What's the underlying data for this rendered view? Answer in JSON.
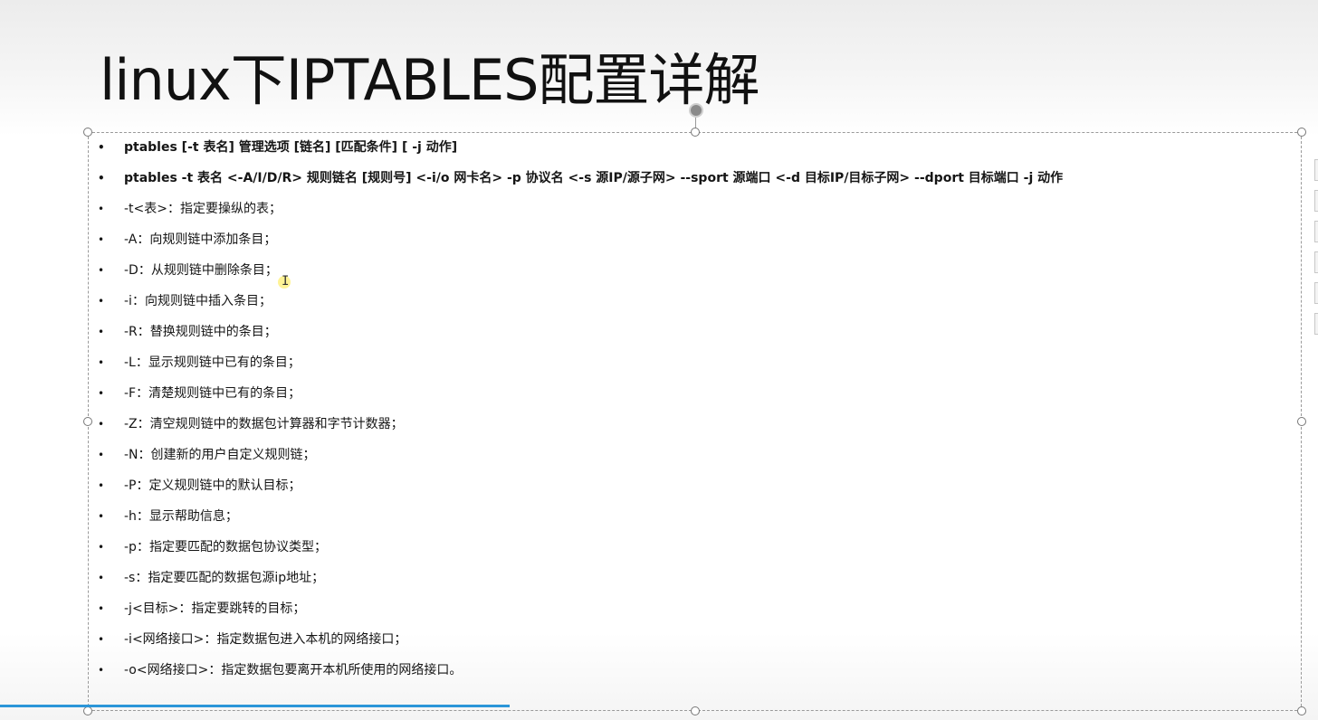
{
  "slide": {
    "title": "linux下IPTABLES配置详解",
    "bullet_glyph": "•",
    "items": [
      {
        "text": "ptables  [-t 表名]  管理选项  [链名]  [匹配条件]  [ -j 动作]",
        "bold": true
      },
      {
        "text": "ptables -t 表名 <-A/I/D/R> 规则链名 [规则号] <-i/o 网卡名> -p 协议名 <-s 源IP/源子网> --sport 源端口 <-d 目标IP/目标子网> --dport 目标端口 -j 动作",
        "bold": true
      },
      {
        "text": "-t<表>：指定要操纵的表；",
        "bold": false
      },
      {
        "text": "-A：向规则链中添加条目；",
        "bold": false
      },
      {
        "text": "-D：从规则链中删除条目；",
        "bold": false
      },
      {
        "text": "-i：向规则链中插入条目；",
        "bold": false
      },
      {
        "text": "-R：替换规则链中的条目；",
        "bold": false
      },
      {
        "text": "-L：显示规则链中已有的条目；",
        "bold": false
      },
      {
        "text": "-F：清楚规则链中已有的条目；",
        "bold": false
      },
      {
        "text": "-Z：清空规则链中的数据包计算器和字节计数器；",
        "bold": false
      },
      {
        "text": "-N：创建新的用户自定义规则链；",
        "bold": false
      },
      {
        "text": "-P：定义规则链中的默认目标；",
        "bold": false
      },
      {
        "text": "-h：显示帮助信息；",
        "bold": false
      },
      {
        "text": "-p：指定要匹配的数据包协议类型；",
        "bold": false
      },
      {
        "text": "-s：指定要匹配的数据包源ip地址；",
        "bold": false
      },
      {
        "text": "-j<目标>：指定要跳转的目标；",
        "bold": false
      },
      {
        "text": "-i<网络接口>：指定数据包进入本机的网络接口；",
        "bold": false
      },
      {
        "text": "-o<网络接口>：指定数据包要离开本机所使用的网络接口。",
        "bold": false
      }
    ]
  },
  "video_progress": 0.387,
  "colors": {
    "progress": "#2b95d8",
    "text": "#151515",
    "selection_border": "#9a9a9a"
  },
  "icons": {
    "rotate_handle": "rotate-handle-icon",
    "text_cursor": "i-beam-cursor-icon"
  }
}
